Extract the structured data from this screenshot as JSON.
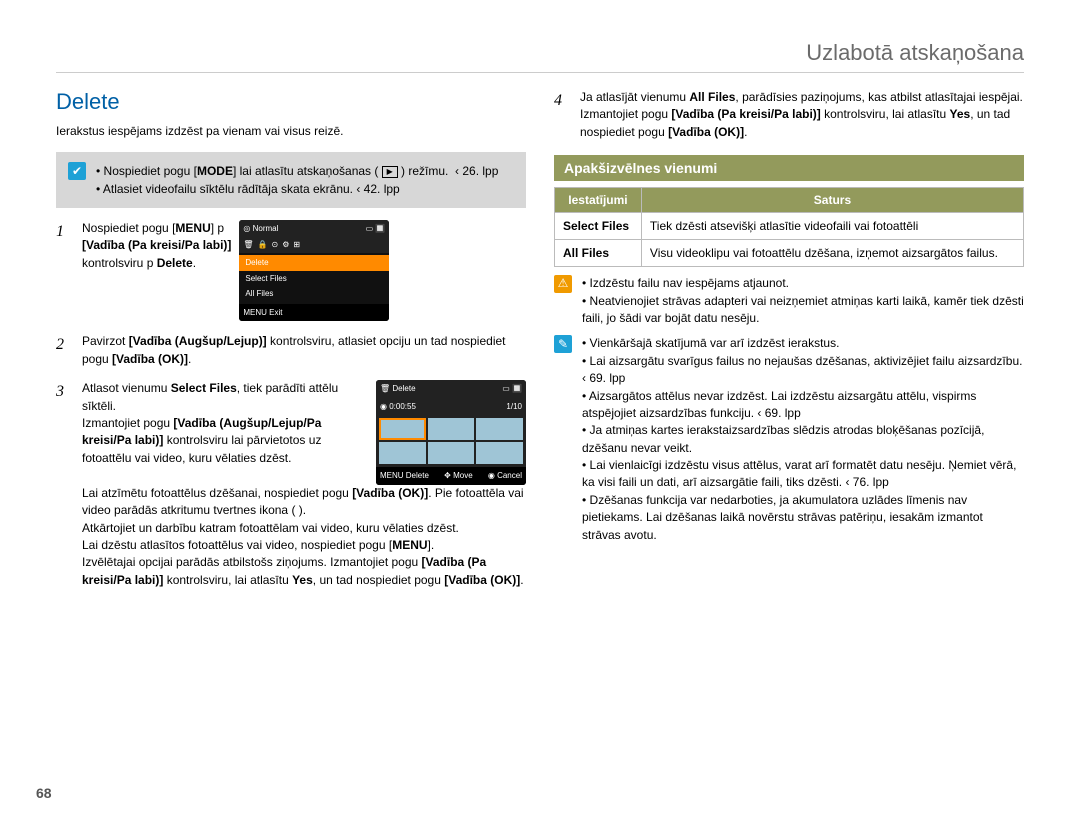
{
  "chapter_title": "Uzlabotā atskaņošana",
  "section_title": "Delete",
  "intro": "Ierakstus iespējams izdzēst pa vienam vai visus reizē.",
  "page_number": "68",
  "greybox_left": {
    "items": [
      "Nospiediet pogu [MODE] lai atlasītu atskaņošanas (        ) režīmu.  ‹ 26. lpp",
      "Atlasiet videofailu sīktēlu rādītāja skata ekrānu.  ‹ 42. lpp"
    ]
  },
  "steps": {
    "s1": {
      "num": "1",
      "text_a": "Nospiediet pogu [",
      "text_b1": "MENU",
      "text_c": "]  p ",
      "bold_d": "[Vadība (Pa kreisi/Pa labi)]",
      "text_e": " kontrolsviru  p ",
      "bold_f": "Delete"
    },
    "s2": {
      "num": "2",
      "text_a": "Pavirzot ",
      "bold_b": "[Vadība (Augšup/Lejup)]",
      "text_c": " kontrolsviru, atlasiet opciju un tad nospiediet pogu ",
      "bold_d": "[Vadība (OK)]"
    },
    "s3": {
      "num": "3",
      "text_a": "Atlasot vienumu ",
      "bold_b": "Select Files",
      "text_c": ", tiek parādīti attēlu sīktēli.",
      "line2_a": "Izmantojiet pogu ",
      "line2_bold": "[Vadība (Augšup/Lejup/Pa kreisi/Pa labi)]",
      "line2_c": " kontrolsviru lai pārvietotos uz fotoattēlu vai video, kuru vēlaties dzēst.",
      "line3_a": "Lai atzīmētu fotoattēlus dzēšanai, nospiediet pogu ",
      "line3_bold": "[Vadība (OK)]",
      "line3_c": ". Pie fotoattēla vai video parādās atkritumu tvertnes ikona (    ).",
      "line4": "Atkārtojiet     un     darbību katram fotoattēlam vai video, kuru vēlaties dzēst.",
      "line5_a": "Lai dzēstu atlasītos fotoattēlus vai video, nospiediet pogu [",
      "line5_bold": "MENU",
      "line5_c": "].",
      "line6_a": "Izvēlētajai opcijai parādās atbilstošs ziņojums. Izmantojiet pogu ",
      "line6_bold": "[Vadība (Pa kreisi/Pa labi)]",
      "line6_c": " kontrolsviru, lai atlasītu ",
      "line6_bold2": "Yes",
      "line6_d": ", un tad nospiediet pogu ",
      "line6_bold3": "[Vadība (OK)]"
    },
    "s4": {
      "num": "4",
      "text_a": "Ja atlasījāt vienumu ",
      "bold_b": "All Files",
      "text_c": ", parādīsies paziņojums, kas atbilst atlasītajai iespējai. Izmantojiet pogu ",
      "bold_d": "[Vadība (Pa kreisi/Pa labi)]",
      "text_e": " kontrolsviru, lai atlasītu ",
      "bold_f": "Yes",
      "text_g": ", un tad nospiediet pogu ",
      "bold_h": "[Vadība (OK)]"
    }
  },
  "subheader": "Apakšizvēlnes vienumi",
  "table": {
    "head1": "Iestatījumi",
    "head2": "Saturs",
    "r1c1": "Select Files",
    "r1c2": "Tiek dzēsti atsevišķi atlasītie videofaili vai fotoattēli",
    "r2c1": "All Files",
    "r2c2": "Visu videoklipu vai fotoattēlu dzēšana, izņemot aizsargātos failus."
  },
  "warn_notes": [
    "Izdzēstu failu nav iespējams atjaunot.",
    "Neatvienojiet strāvas adapteri vai neizņemiet atmiņas karti laikā, kamēr tiek dzēsti faili, jo šādi var bojāt datu nesēju."
  ],
  "info_notes": [
    "Vienkāršajā skatījumā var arī izdzēst ierakstus.",
    "Lai aizsargātu svarīgus failus no nejaušas dzēšanas, aktivizējiet failu aizsardzību.  ‹ 69. lpp",
    "Aizsargātos attēlus nevar izdzēst. Lai izdzēstu aizsargātu attēlu, vispirms atspējojiet aizsardzības funkciju.  ‹ 69. lpp",
    "Ja atmiņas kartes ierakstaizsardzības slēdzis atrodas bloķēšanas pozīcijā, dzēšanu nevar veikt.",
    "Lai vienlaicīgi izdzēstu visus attēlus, varat arī formatēt datu nesēju. Ņemiet vērā, ka visi faili un dati, arī aizsargātie faili, tiks dzēsti.  ‹ 76. lpp",
    "Dzēšanas funkcija var nedarboties, ja akumulatora uzlādes līmenis nav pietiekams. Lai dzēšanas laikā novērstu strāvas patēriņu, iesakām izmantot strāvas avotu."
  ],
  "lcd1": {
    "title": "Normal",
    "items": [
      "Delete",
      "Select Files",
      "All Files"
    ],
    "foot": "MENU Exit"
  },
  "lcd2": {
    "title": "Delete",
    "time": "0:00:55",
    "count": "1/10",
    "foot_l": "MENU Delete",
    "foot_m": "Move",
    "foot_r": "Cancel"
  }
}
